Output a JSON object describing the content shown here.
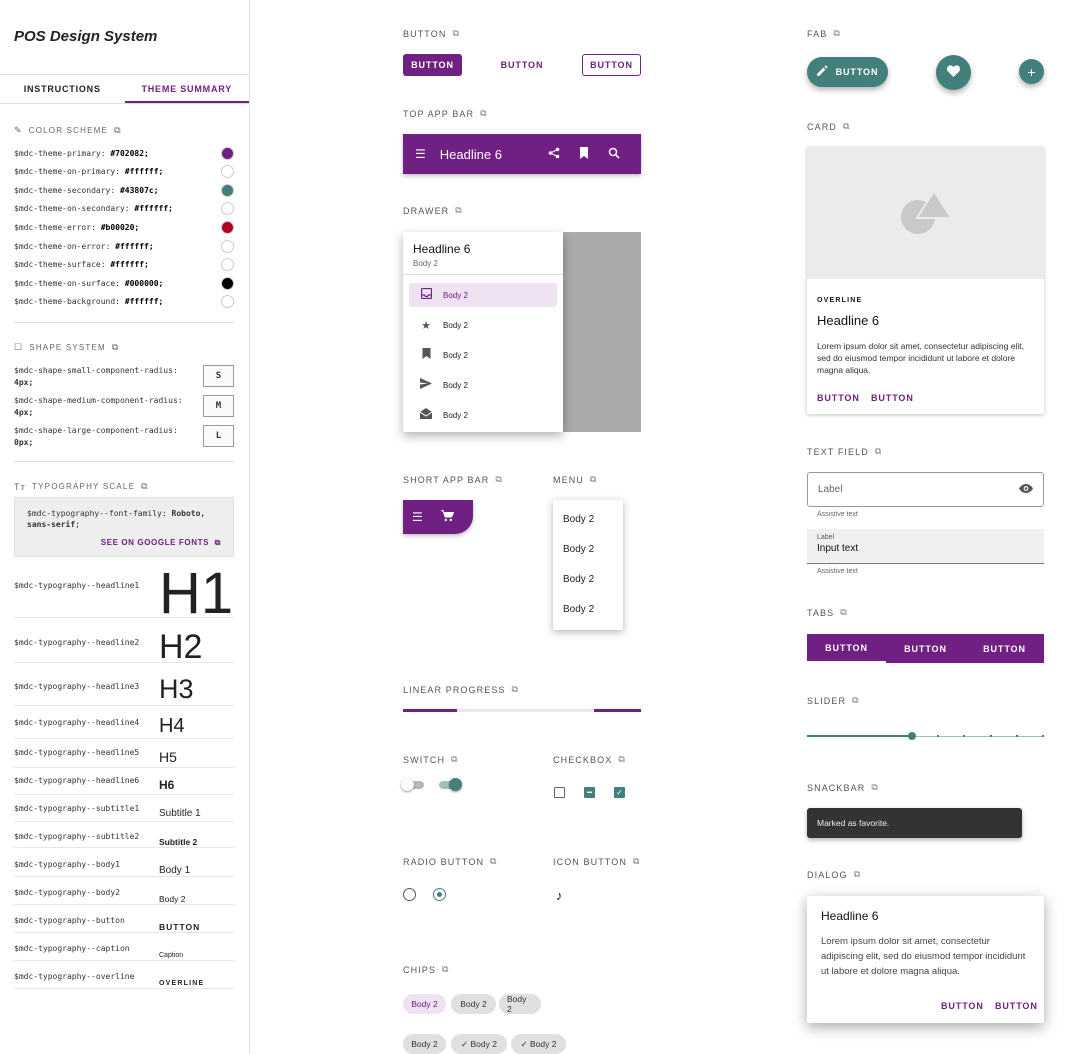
{
  "app": {
    "title": "POS Design System"
  },
  "sidebar": {
    "tabs": [
      {
        "label": "INSTRUCTIONS"
      },
      {
        "label": "THEME SUMMARY"
      }
    ],
    "color_scheme": {
      "heading": "COLOR SCHEME",
      "vars": [
        {
          "name": "$mdc-theme-primary:",
          "value": "#702082;",
          "color": "#702082"
        },
        {
          "name": "$mdc-theme-on-primary:",
          "value": "#ffffff;",
          "color": "#ffffff"
        },
        {
          "name": "$mdc-theme-secondary:",
          "value": "#43807c;",
          "color": "#43807c"
        },
        {
          "name": "$mdc-theme-on-secondary:",
          "value": "#ffffff;",
          "color": "#ffffff"
        },
        {
          "name": "$mdc-theme-error:",
          "value": "#b00020;",
          "color": "#b00020"
        },
        {
          "name": "$mdc-theme-on-error:",
          "value": "#ffffff;",
          "color": "#ffffff"
        },
        {
          "name": "$mdc-theme-surface:",
          "value": "#ffffff;",
          "color": "#ffffff"
        },
        {
          "name": "$mdc-theme-on-surface:",
          "value": "#000000;",
          "color": "#000000"
        },
        {
          "name": "$mdc-theme-background:",
          "value": "#ffffff;",
          "color": "#ffffff"
        }
      ]
    },
    "shape_system": {
      "heading": "SHAPE SYSTEM",
      "rows": [
        {
          "name": "$mdc-shape-small-component-radius:",
          "value": "4px;",
          "box": "S"
        },
        {
          "name": "$mdc-shape-medium-component-radius:",
          "value": "4px;",
          "box": "M"
        },
        {
          "name": "$mdc-shape-large-component-radius:",
          "value": "0px;",
          "box": "L"
        }
      ]
    },
    "typography": {
      "heading": "TYPOGRAPHY SCALE",
      "font_family_var": "$mdc-typography--font-family:",
      "font_family_value": "Roboto, sans-serif",
      "font_family_end": ";",
      "google_fonts_link": "SEE ON GOOGLE FONTS",
      "rows": [
        {
          "name": "$mdc-typography--headline1",
          "sample": "H1"
        },
        {
          "name": "$mdc-typography--headline2",
          "sample": "H2"
        },
        {
          "name": "$mdc-typography--headline3",
          "sample": "H3"
        },
        {
          "name": "$mdc-typography--headline4",
          "sample": "H4"
        },
        {
          "name": "$mdc-typography--headline5",
          "sample": "H5"
        },
        {
          "name": "$mdc-typography--headline6",
          "sample": "H6"
        },
        {
          "name": "$mdc-typography--subtitle1",
          "sample": "Subtitle 1"
        },
        {
          "name": "$mdc-typography--subtitle2",
          "sample": "Subtitle 2"
        },
        {
          "name": "$mdc-typography--body1",
          "sample": "Body 1"
        },
        {
          "name": "$mdc-typography--body2",
          "sample": "Body 2"
        },
        {
          "name": "$mdc-typography--button",
          "sample": "BUTTON"
        },
        {
          "name": "$mdc-typography--caption",
          "sample": "Caption"
        },
        {
          "name": "$mdc-typography--overline",
          "sample": "OVERLINE"
        }
      ]
    }
  },
  "sections": {
    "button": "BUTTON",
    "top_app_bar": "TOP APP BAR",
    "drawer": "DRAWER",
    "short_app_bar": "SHORT APP BAR",
    "menu": "MENU",
    "linear_progress": "LINEAR PROGRESS",
    "switch": "SWITCH",
    "checkbox": "CHECKBOX",
    "radio_button": "RADIO BUTTON",
    "icon_button": "ICON BUTTON",
    "chips": "CHIPS",
    "fab": "FAB",
    "card": "CARD",
    "text_field": "TEXT FIELD",
    "tabs": "TABS",
    "slider": "SLIDER",
    "snackbar": "SNACKBAR",
    "dialog": "DIALOG"
  },
  "buttons": {
    "contained": "BUTTON",
    "text": "BUTTON",
    "outlined": "BUTTON"
  },
  "top_app_bar": {
    "title": "Headline 6"
  },
  "drawer": {
    "title": "Headline 6",
    "subtitle": "Body 2",
    "items": [
      {
        "label": "Body 2",
        "icon": "inbox-icon"
      },
      {
        "label": "Body 2",
        "icon": "star-icon"
      },
      {
        "label": "Body 2",
        "icon": "bookmark-icon"
      },
      {
        "label": "Body 2",
        "icon": "send-icon"
      },
      {
        "label": "Body 2",
        "icon": "drafts-icon"
      }
    ]
  },
  "menu": {
    "items": [
      "Body 2",
      "Body 2",
      "Body 2",
      "Body 2"
    ]
  },
  "chips": {
    "row1": [
      {
        "label": "Body 2"
      },
      {
        "label": "Body 2"
      },
      {
        "label": "Body 2"
      }
    ],
    "row2": [
      {
        "label": "Body 2"
      },
      {
        "label": "Body 2"
      },
      {
        "label": "Body 2"
      }
    ]
  },
  "fab": {
    "extended_label": "BUTTON"
  },
  "card": {
    "overline": "OVERLINE",
    "title": "Headline 6",
    "body": "Lorem ipsum dolor sit amet, consectetur adipiscing elit, sed do eiusmod tempor incididunt ut labore et dolore magna aliqua.",
    "actions": [
      "BUTTON",
      "BUTTON"
    ]
  },
  "text_field": {
    "outlined_label": "Label",
    "outlined_helper": "Assistive text",
    "filled_label": "Label",
    "filled_value": "Input text",
    "filled_helper": "Assistive text"
  },
  "tabs": [
    "BUTTON",
    "BUTTON",
    "BUTTON"
  ],
  "snackbar": {
    "message": "Marked as favorite."
  },
  "dialog": {
    "title": "Headline 6",
    "body": "Lorem ipsum dolor sit amet, consectetur adipiscing elit, sed do eiusmod tempor incididunt ut labore et dolore magna aliqua.",
    "actions": [
      "BUTTON",
      "BUTTON"
    ]
  },
  "colors": {
    "primary": "#702082",
    "secondary": "#43807c",
    "error": "#b00020"
  }
}
